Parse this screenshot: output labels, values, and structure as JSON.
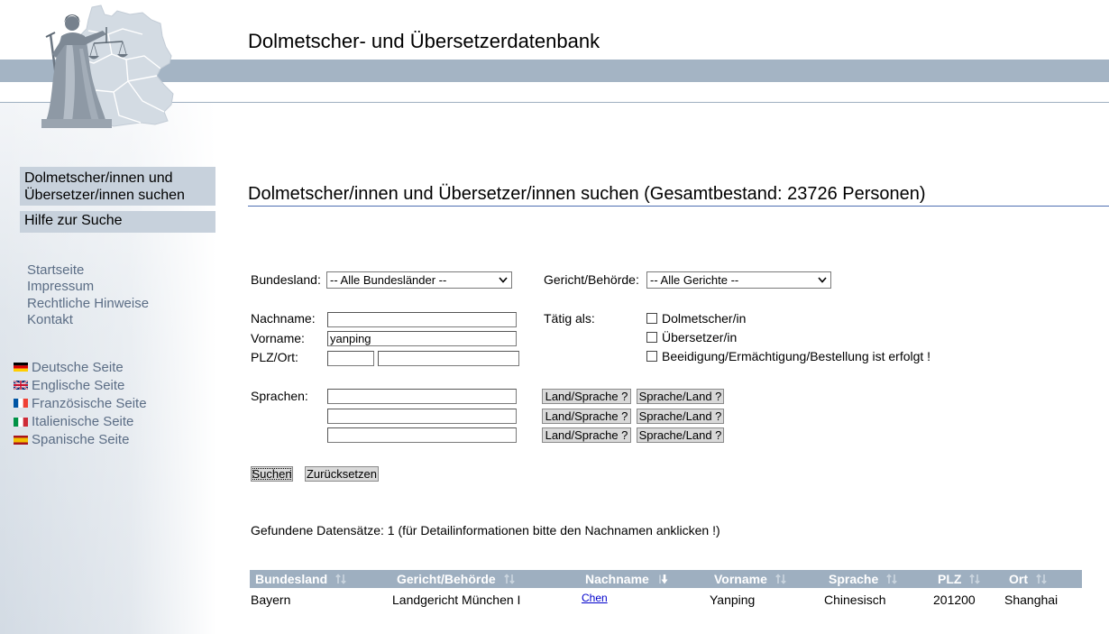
{
  "header": {
    "title": "Dolmetscher- und Übersetzerdatenbank",
    "logo_icon": "justitia-map-logo-icon"
  },
  "sidebar": {
    "menu": [
      {
        "label": "Dolmetscher/innen und Übersetzer/innen suchen",
        "active": true
      },
      {
        "label": "Hilfe zur Suche",
        "active": false
      }
    ],
    "links": [
      {
        "label": "Startseite"
      },
      {
        "label": "Impressum"
      },
      {
        "label": "Rechtliche Hinweise"
      },
      {
        "label": "Kontakt"
      }
    ],
    "languages": [
      {
        "label": "Deutsche Seite",
        "icon": "flag-germany-icon"
      },
      {
        "label": "Englische Seite",
        "icon": "flag-uk-icon"
      },
      {
        "label": "Französische Seite",
        "icon": "flag-france-icon"
      },
      {
        "label": "Italienische Seite",
        "icon": "flag-italy-icon"
      },
      {
        "label": "Spanische Seite",
        "icon": "flag-spain-icon"
      }
    ]
  },
  "main": {
    "heading": "Dolmetscher/innen und Übersetzer/innen suchen (Gesamtbestand: 23726 Personen)",
    "form": {
      "bundesland": {
        "label": "Bundesland:",
        "selected": "-- Alle Bundesländer --"
      },
      "gericht": {
        "label": "Gericht/Behörde:",
        "selected": "-- Alle Gerichte --"
      },
      "nachname": {
        "label": "Nachname:",
        "value": ""
      },
      "vorname": {
        "label": "Vorname:",
        "value": "yanping"
      },
      "plz_ort": {
        "label": "PLZ/Ort:",
        "plz_value": "",
        "ort_value": ""
      },
      "taetig_als": {
        "label": "Tätig als:",
        "options": [
          {
            "label": "Dolmetscher/in",
            "checked": false
          },
          {
            "label": "Übersetzer/in",
            "checked": false
          },
          {
            "label": "Beeidigung/Ermächtigung/Bestellung ist erfolgt !",
            "checked": false
          }
        ]
      },
      "sprachen": {
        "label": "Sprachen:",
        "rows": [
          {
            "value": "",
            "land_sprache_label": "Land/Sprache ?",
            "sprache_land_label": "Sprache/Land ?"
          },
          {
            "value": "",
            "land_sprache_label": "Land/Sprache ?",
            "sprache_land_label": "Sprache/Land ?"
          },
          {
            "value": "",
            "land_sprache_label": "Land/Sprache ?",
            "sprache_land_label": "Sprache/Land ?"
          }
        ]
      },
      "submit_label": "Suchen",
      "reset_label": "Zurücksetzen"
    },
    "results": {
      "summary": "Gefundene Datensätze: 1 (für Detailinformationen bitte den Nachnamen anklicken !)",
      "columns": [
        {
          "label": "Bundesland",
          "sort_icon": "sort-both-icon"
        },
        {
          "label": "Gericht/Behörde",
          "sort_icon": "sort-both-icon"
        },
        {
          "label": "Nachname",
          "sort_icon": "sort-down-icon"
        },
        {
          "label": "Vorname",
          "sort_icon": "sort-both-icon"
        },
        {
          "label": "Sprache",
          "sort_icon": "sort-both-icon"
        },
        {
          "label": "PLZ",
          "sort_icon": "sort-both-icon"
        },
        {
          "label": "Ort",
          "sort_icon": "sort-both-icon"
        }
      ],
      "rows": [
        [
          "Bayern",
          "Landgericht München I",
          "Chen",
          "Yanping",
          "Chinesisch",
          "201200",
          "Shanghai"
        ]
      ]
    }
  },
  "colors": {
    "header_band": "#a4b4c4",
    "menu_bg": "#c7d1dc",
    "link": "#5b6d85",
    "table_header_bg": "#9eafc0",
    "heading_rule": "#4f6fb3",
    "result_link": "#0000cc"
  }
}
